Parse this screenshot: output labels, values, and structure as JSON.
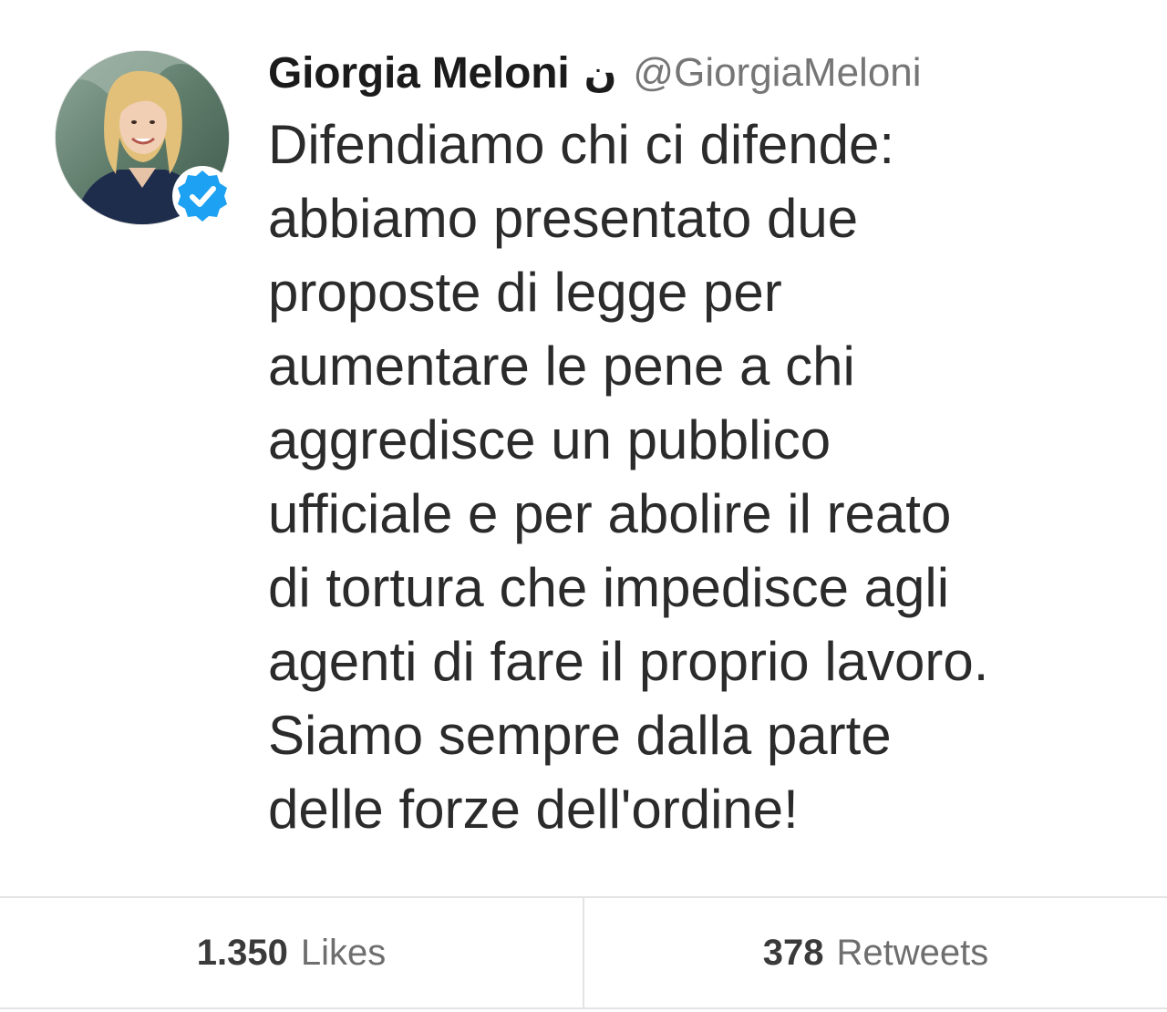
{
  "tweet": {
    "author": {
      "name": "Giorgia Meloni",
      "name_glyph": "ن",
      "handle": "@GiorgiaMeloni",
      "verified_icon": "verified-badge-icon",
      "verified_color": "#1da1f2"
    },
    "text_lines": [
      "Difendiamo chi ci difende:",
      "abbiamo presentato due",
      "proposte di legge per",
      "aumentare le pene a chi",
      "aggredisce un pubblico",
      "ufficiale e per abolire il reato",
      "di tortura che impedisce agli",
      "agenti di fare il proprio lavoro.",
      "Siamo sempre dalla parte",
      "delle forze dell'ordine!"
    ]
  },
  "stats": {
    "likes": {
      "count": "1.350",
      "label": "Likes"
    },
    "retweets": {
      "count": "378",
      "label": "Retweets"
    }
  }
}
